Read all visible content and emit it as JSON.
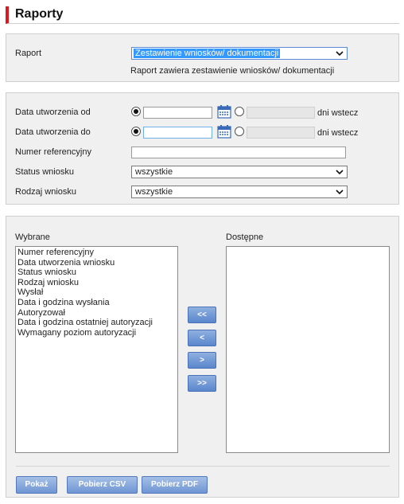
{
  "page_title": "Raporty",
  "report": {
    "label": "Raport",
    "selected": "Zestawienie wniosków/ dokumentacji",
    "description": "Raport zawiera zestawienie wniosków/ dokumentacji"
  },
  "filters": {
    "date_from": {
      "label": "Data utworzenia od",
      "value": "",
      "days_suffix": "dni wstecz"
    },
    "date_to": {
      "label": "Data utworzenia do",
      "value": "",
      "days_suffix": "dni wstecz"
    },
    "reference_number": {
      "label": "Numer referencyjny",
      "value": ""
    },
    "status": {
      "label": "Status wniosku",
      "selected": "wszystkie"
    },
    "type": {
      "label": "Rodzaj wniosku",
      "selected": "wszystkie"
    }
  },
  "columns": {
    "selected_label": "Wybrane",
    "available_label": "Dostępne",
    "selected_items": [
      "Numer referencyjny",
      "Data utworzenia wniosku",
      "Status wniosku",
      "Rodzaj wniosku",
      "Wysłał",
      "Data i godzina wysłania",
      "Autoryzował",
      "Data i godzina ostatniej autoryzacji",
      "Wymagany poziom autoryzacji"
    ],
    "available_items": [],
    "move_buttons": {
      "all_left": "<<",
      "one_left": "<",
      "one_right": ">",
      "all_right": ">>"
    }
  },
  "actions": {
    "show": "Pokaż",
    "csv": "Pobierz CSV",
    "pdf": "Pobierz PDF"
  },
  "colors": {
    "accent": "#d9181f",
    "panel_bg": "#f0f0f0",
    "button_blue": "#6f95d3",
    "selection_blue": "#3399ff"
  }
}
